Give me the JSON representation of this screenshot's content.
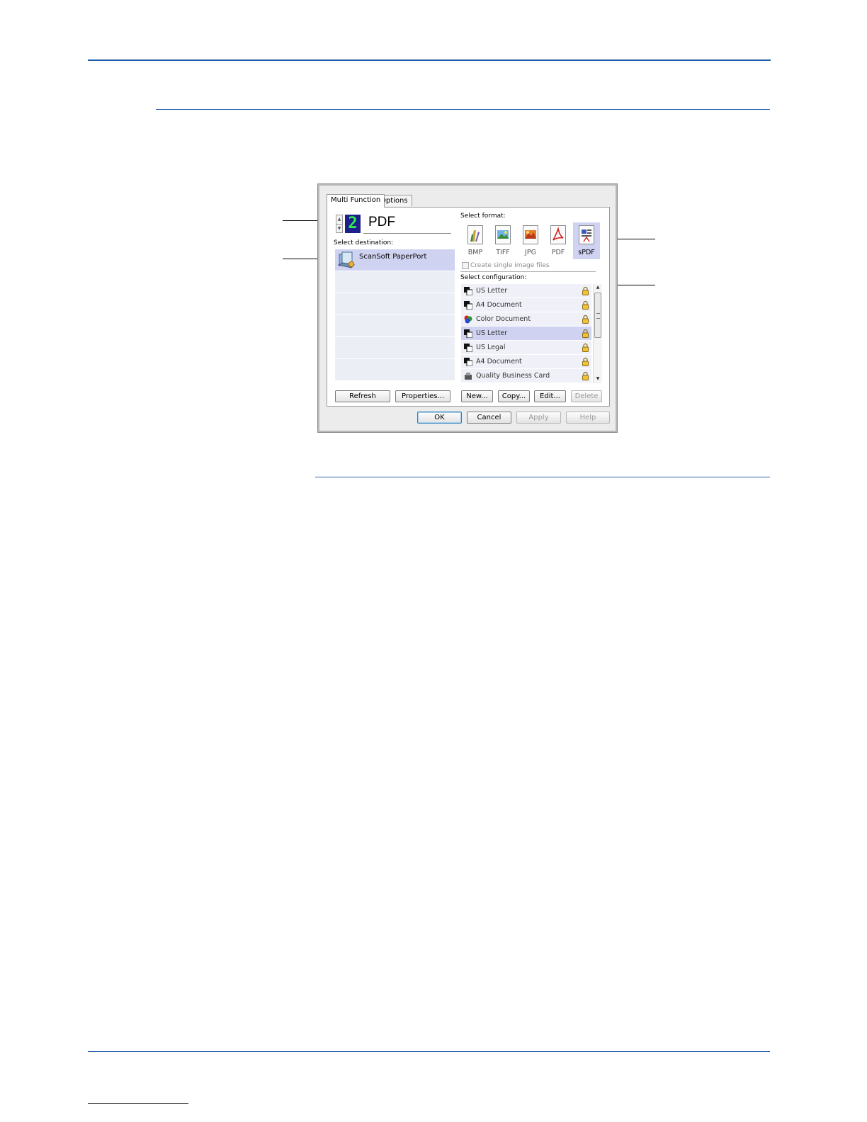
{
  "dialog": {
    "tabs": [
      {
        "label": "Multi Function"
      },
      {
        "label": "Options"
      }
    ],
    "button_number": "2",
    "format_name": "PDF",
    "select_destination_label": "Select destination:",
    "destinations": [
      {
        "label": "ScanSoft PaperPort",
        "selected": true
      }
    ],
    "select_format_label": "Select format:",
    "formats": [
      {
        "label": "BMP",
        "icon": "bmp-file-icon"
      },
      {
        "label": "TIFF",
        "icon": "tiff-file-icon"
      },
      {
        "label": "JPG",
        "icon": "jpg-file-icon"
      },
      {
        "label": "PDF",
        "icon": "pdf-file-icon"
      },
      {
        "label": "sPDF",
        "icon": "spdf-file-icon",
        "selected": true
      }
    ],
    "create_single_files_label": "Create single image files",
    "select_configuration_label": "Select configuration:",
    "configurations": [
      {
        "label": "US Letter",
        "icon": "bw-scan-icon"
      },
      {
        "label": "A4 Document",
        "icon": "bw-scan-icon"
      },
      {
        "label": "Color Document",
        "icon": "color-scan-icon"
      },
      {
        "label": "US Letter",
        "icon": "bw-scan-icon",
        "selected": true
      },
      {
        "label": "US Legal",
        "icon": "bw-scan-icon"
      },
      {
        "label": "A4 Document",
        "icon": "bw-scan-icon"
      },
      {
        "label": "Quality Business Card",
        "icon": "card-scan-icon"
      }
    ],
    "buttons": {
      "refresh": "Refresh",
      "properties": "Properties...",
      "new": "New...",
      "copy": "Copy...",
      "edit": "Edit...",
      "delete": "Delete",
      "ok": "OK",
      "cancel": "Cancel",
      "apply": "Apply",
      "help": "Help"
    }
  },
  "colors": {
    "accent_rule": "#1a5aa8",
    "selection": "#cfd2f0",
    "led_bg": "#1d1f8a",
    "led_digit": "#2cf04b"
  }
}
